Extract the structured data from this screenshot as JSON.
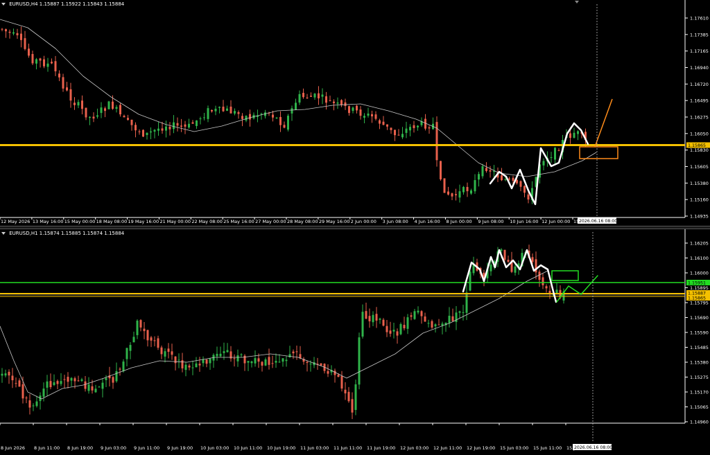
{
  "colors": {
    "bull": "#2fb34a",
    "bear": "#e8604c",
    "ma": "#c8c8c8",
    "axis": "#ffffff",
    "support": "#f4c000",
    "green_level": "#22dd22",
    "orange": "#ff8c1a",
    "white_pattern": "#ffffff"
  },
  "pane1": {
    "symbol_label": "EURUSD,H4",
    "ohlc": "1.15887 1.15922 1.15843 1.15884",
    "price_ticks": [
      "1.17610",
      "1.17385",
      "1.17165",
      "1.16940",
      "1.16720",
      "1.16495",
      "1.16275",
      "1.16050",
      "1.15830",
      "1.15605",
      "1.15380",
      "1.15160",
      "1.14935"
    ],
    "current_price_tag": "1.15865",
    "time_labels": [
      "12 May 2026",
      "13 May 16:00",
      "15 May 00:00",
      "18 May 08:00",
      "19 May 16:00",
      "21 May 00:00",
      "22 May 08:00",
      "25 May 16:00",
      "27 May 00:00",
      "28 May 08:00",
      "29 May 16:00",
      "2 Jun 00:00",
      "3 Jun 08:00",
      "4 Jun 16:00",
      "8 Jun 00:00",
      "9 Jun 08:00",
      "10 Jun 16:00",
      "12 Jun 00:00",
      "15"
    ],
    "cursor_date": "2026.06.16 08:00"
  },
  "pane2": {
    "symbol_label": "EURUSD,H1",
    "ohlc": "1.15874 1.15885 1.15874 1.15884",
    "price_ticks": [
      "1.16205",
      "1.16100",
      "1.16000",
      "1.15895",
      "1.15795",
      "1.15690",
      "1.15590",
      "1.15485",
      "1.15380",
      "1.15275",
      "1.15170",
      "1.15065",
      "1.14960"
    ],
    "green_level_tag": "1.15951",
    "current_price_tag": "1.15887",
    "support_tag": "1.15865",
    "time_labels": [
      "8 Jun 2026",
      "8 Jun 11:00",
      "8 Jun 19:00",
      "9 Jun 03:00",
      "9 Jun 11:00",
      "9 Jun 19:00",
      "10 Jun 03:00",
      "10 Jun 11:00",
      "10 Jun 19:00",
      "11 Jun 03:00",
      "11 Jun 11:00",
      "11 Jun 19:00",
      "12 Jun 03:00",
      "12 Jun 11:00",
      "12 Jun 19:00",
      "15 Jun 03:00",
      "15 Jun 11:00",
      "15 Jun 19:00"
    ],
    "cursor_date": "2026.06.16 08:00"
  }
}
